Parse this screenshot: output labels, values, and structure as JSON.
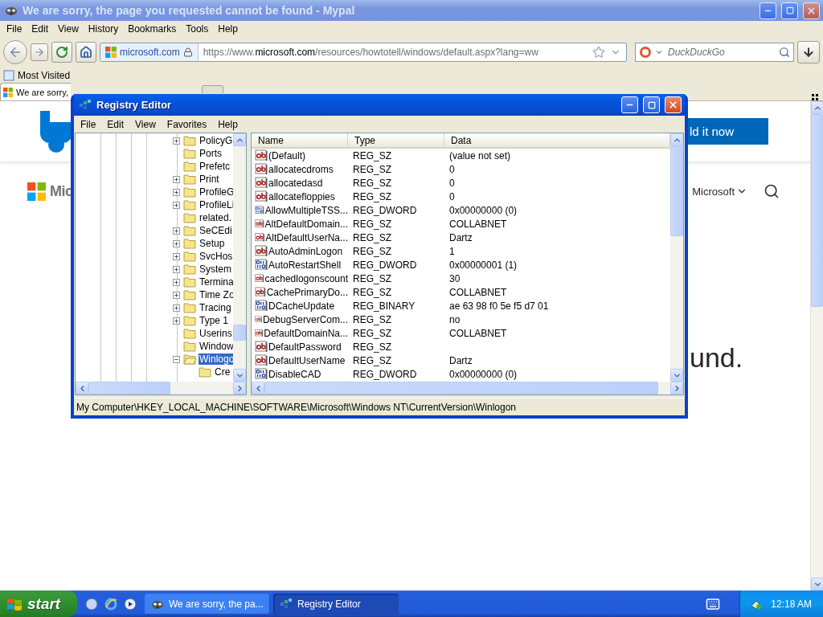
{
  "browser": {
    "title": "We are sorry, the page you requested cannot be found - Mypal",
    "menu": [
      "File",
      "Edit",
      "View",
      "History",
      "Bookmarks",
      "Tools",
      "Help"
    ],
    "address": {
      "identity": "microsoft.com",
      "url": "https://www.**microsoft.com**/resources/howtotell/windows/default.aspx?lang=ww"
    },
    "search": {
      "placeholder": "DuckDuckGo"
    },
    "bookmarks": [
      {
        "label": "Most Visited"
      }
    ],
    "tabs": [
      {
        "label": "We are sorry,",
        "selected": true
      }
    ],
    "page": {
      "banner_button": "ld it now",
      "logo_text": "Mic",
      "nav_link": "Microsoft",
      "heading": "und."
    }
  },
  "registry_editor": {
    "title": "Registry Editor",
    "menu": [
      "File",
      "Edit",
      "View",
      "Favorites",
      "Help"
    ],
    "tree": [
      {
        "label": "PolicyG",
        "has_children": true,
        "expanded": false,
        "selected": false
      },
      {
        "label": "Ports",
        "has_children": false,
        "expanded": false,
        "selected": false
      },
      {
        "label": "Prefetc",
        "has_children": false,
        "expanded": false,
        "selected": false
      },
      {
        "label": "Print",
        "has_children": true,
        "expanded": false,
        "selected": false
      },
      {
        "label": "ProfileG",
        "has_children": true,
        "expanded": false,
        "selected": false
      },
      {
        "label": "ProfileLi",
        "has_children": true,
        "expanded": false,
        "selected": false
      },
      {
        "label": "related.",
        "has_children": false,
        "expanded": false,
        "selected": false
      },
      {
        "label": "SeCEdi",
        "has_children": true,
        "expanded": false,
        "selected": false
      },
      {
        "label": "Setup",
        "has_children": true,
        "expanded": false,
        "selected": false
      },
      {
        "label": "SvcHos",
        "has_children": true,
        "expanded": false,
        "selected": false
      },
      {
        "label": "System",
        "has_children": true,
        "expanded": false,
        "selected": false
      },
      {
        "label": "Termina",
        "has_children": true,
        "expanded": false,
        "selected": false
      },
      {
        "label": "Time Zo",
        "has_children": true,
        "expanded": false,
        "selected": false
      },
      {
        "label": "Tracing",
        "has_children": true,
        "expanded": false,
        "selected": false
      },
      {
        "label": "Type 1",
        "has_children": true,
        "expanded": false,
        "selected": false
      },
      {
        "label": "Userins",
        "has_children": false,
        "expanded": false,
        "selected": false
      },
      {
        "label": "Window",
        "has_children": false,
        "expanded": false,
        "selected": false
      },
      {
        "label": "Winlogo",
        "has_children": true,
        "expanded": true,
        "selected": true,
        "children": [
          {
            "label": "Cre",
            "has_children": false,
            "expanded": false,
            "selected": false
          }
        ]
      }
    ],
    "columns": [
      "Name",
      "Type",
      "Data"
    ],
    "rows": [
      {
        "kind": "string",
        "name": "(Default)",
        "type": "REG_SZ",
        "data": "(value not set)"
      },
      {
        "kind": "string",
        "name": "allocatecdroms",
        "type": "REG_SZ",
        "data": "0"
      },
      {
        "kind": "string",
        "name": "allocatedasd",
        "type": "REG_SZ",
        "data": "0"
      },
      {
        "kind": "string",
        "name": "allocatefloppies",
        "type": "REG_SZ",
        "data": "0"
      },
      {
        "kind": "binary",
        "name": "AllowMultipleTSS...",
        "type": "REG_DWORD",
        "data": "0x00000000 (0)"
      },
      {
        "kind": "string",
        "name": "AltDefaultDomain...",
        "type": "REG_SZ",
        "data": "COLLABNET"
      },
      {
        "kind": "string",
        "name": "AltDefaultUserNa...",
        "type": "REG_SZ",
        "data": "Dartz"
      },
      {
        "kind": "string",
        "name": "AutoAdminLogon",
        "type": "REG_SZ",
        "data": "1"
      },
      {
        "kind": "binary",
        "name": "AutoRestartShell",
        "type": "REG_DWORD",
        "data": "0x00000001 (1)"
      },
      {
        "kind": "string",
        "name": "cachedlogonscount",
        "type": "REG_SZ",
        "data": "30"
      },
      {
        "kind": "string",
        "name": "CachePrimaryDo...",
        "type": "REG_SZ",
        "data": "COLLABNET"
      },
      {
        "kind": "binary",
        "name": "DCacheUpdate",
        "type": "REG_BINARY",
        "data": "ae 63 98 f0 5e f5 d7 01"
      },
      {
        "kind": "string",
        "name": "DebugServerCom...",
        "type": "REG_SZ",
        "data": "no"
      },
      {
        "kind": "string",
        "name": "DefaultDomainNa...",
        "type": "REG_SZ",
        "data": "COLLABNET"
      },
      {
        "kind": "string",
        "name": "DefaultPassword",
        "type": "REG_SZ"
      },
      {
        "kind": "string",
        "name": "DefaultUserName",
        "type": "REG_SZ",
        "data": "Dartz"
      },
      {
        "kind": "binary",
        "name": "DisableCAD",
        "type": "REG_DWORD",
        "data": "0x00000000 (0)"
      }
    ],
    "status_bar": "My Computer\\HKEY_LOCAL_MACHINE\\SOFTWARE\\Microsoft\\Windows NT\\CurrentVersion\\Winlogon"
  },
  "taskbar": {
    "start": "start",
    "tasks": [
      {
        "label": "We are sorry, the pa...",
        "selected": false
      },
      {
        "label": "Registry Editor",
        "selected": true
      }
    ],
    "clock": "12:18 AM"
  }
}
